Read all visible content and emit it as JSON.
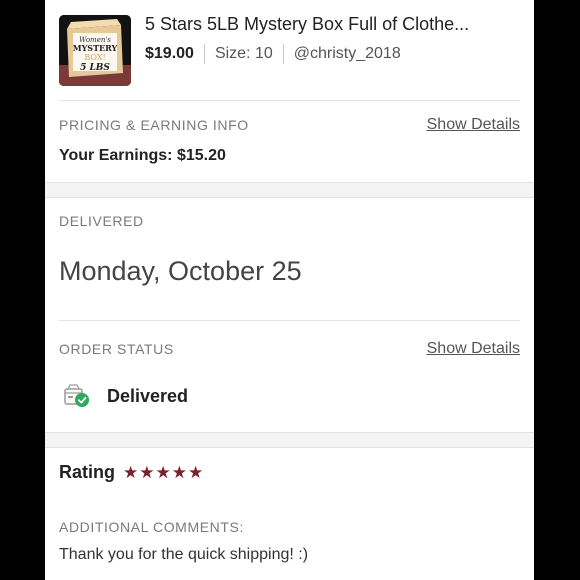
{
  "listing": {
    "title": "5 Stars 5LB Mystery Box Full of Clothe...",
    "price": "$19.00",
    "size": "Size: 10",
    "seller": "@christy_2018",
    "thumbnail": {
      "line1": "Women's",
      "line2": "MYSTERY",
      "line3": "BOX!",
      "line4": "5 LBS"
    }
  },
  "pricing": {
    "label": "PRICING & EARNING INFO",
    "details_link": "Show Details",
    "earnings": "Your Earnings: $15.20"
  },
  "delivery": {
    "label": "DELIVERED",
    "date": "Monday, October 25"
  },
  "order_status": {
    "label": "ORDER STATUS",
    "details_link": "Show Details",
    "status": "Delivered",
    "icon": "delivered-box-check-icon"
  },
  "rating": {
    "label": "Rating",
    "stars": 5,
    "star_color": "#7d1f2e"
  },
  "comments": {
    "label": "ADDITIONAL COMMENTS:",
    "text": "Thank you for the quick shipping! :)"
  },
  "colors": {
    "accent_star": "#7d1f2e",
    "check_green": "#2eaa5c",
    "section_gap": "#f4f4f4"
  }
}
